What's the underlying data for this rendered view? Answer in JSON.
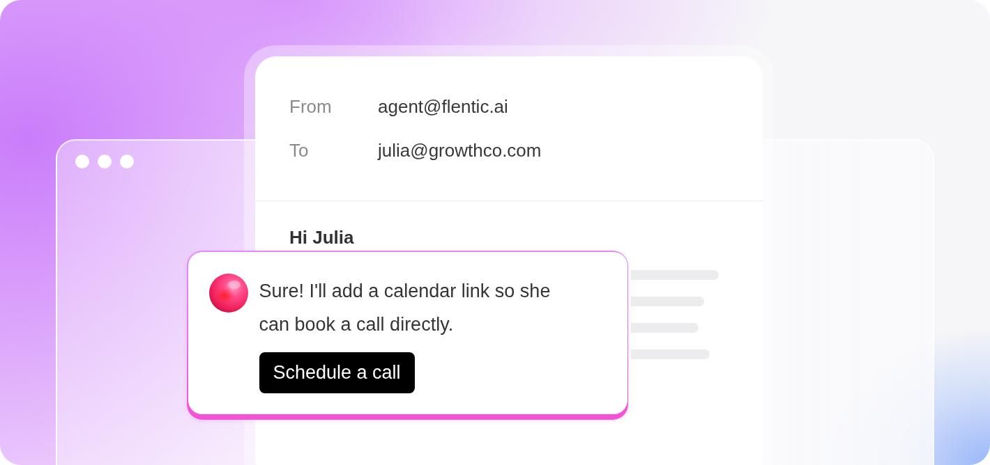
{
  "email": {
    "fields": [
      {
        "label": "From",
        "value": "agent@flentic.ai"
      },
      {
        "label": "To",
        "value": "julia@growthco.com"
      }
    ],
    "greeting": "Hi Julia"
  },
  "chat_popup": {
    "message": "Sure! I'll add a calendar link so she can book a call directly.",
    "button": "Schedule a call"
  }
}
